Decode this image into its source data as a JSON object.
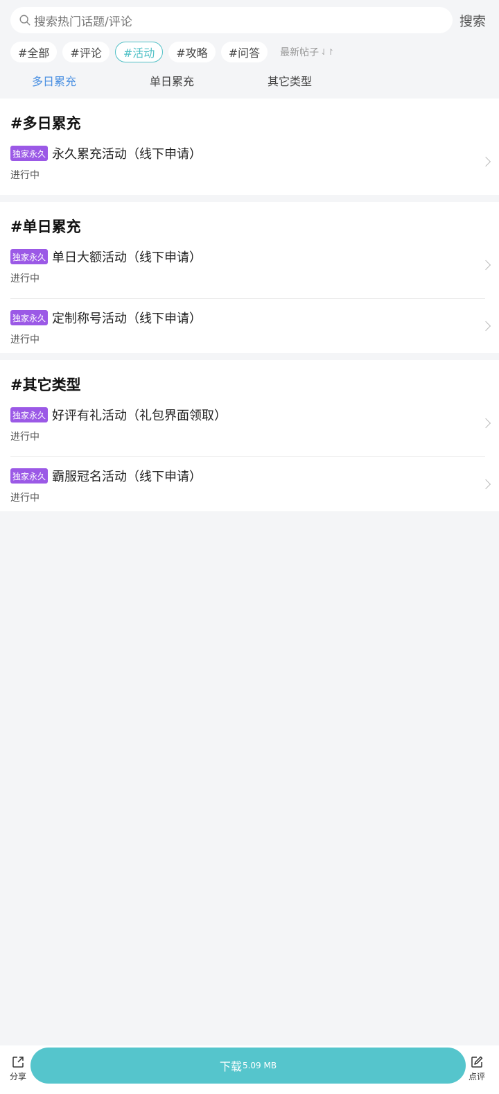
{
  "search": {
    "placeholder": "搜索热门话题/评论",
    "button_label": "搜索"
  },
  "tags": [
    {
      "label": "#全部",
      "active": false
    },
    {
      "label": "#评论",
      "active": false
    },
    {
      "label": "#活动",
      "active": true
    },
    {
      "label": "#攻略",
      "active": false
    },
    {
      "label": "#问答",
      "active": false
    }
  ],
  "sort": {
    "label": "最新帖子",
    "icon": "sort-arrows-icon"
  },
  "subtabs": [
    {
      "label": "多日累充",
      "active": true
    },
    {
      "label": "单日累充",
      "active": false
    },
    {
      "label": "其它类型",
      "active": false
    }
  ],
  "sections": [
    {
      "title": "#多日累充",
      "items": [
        {
          "badge": "独家永久",
          "title": "永久累充活动（线下申请）",
          "status": "进行中"
        }
      ]
    },
    {
      "title": "#单日累充",
      "items": [
        {
          "badge": "独家永久",
          "title": "单日大额活动（线下申请）",
          "status": "进行中"
        },
        {
          "badge": "独家永久",
          "title": "定制称号活动（线下申请）",
          "status": "进行中"
        }
      ]
    },
    {
      "title": "#其它类型",
      "items": [
        {
          "badge": "独家永久",
          "title": "好评有礼活动（礼包界面领取）",
          "status": "进行中"
        },
        {
          "badge": "独家永久",
          "title": "霸服冠名活动（线下申请）",
          "status": "进行中"
        }
      ]
    }
  ],
  "footer": {
    "share_label": "分享",
    "download_label": "下载",
    "download_size": "5.09 MB",
    "review_label": "点评"
  },
  "colors": {
    "accent": "#4fc0c6",
    "tab_active": "#4a90e2",
    "badge": "#9b59e6",
    "download": "#55c5cc"
  }
}
